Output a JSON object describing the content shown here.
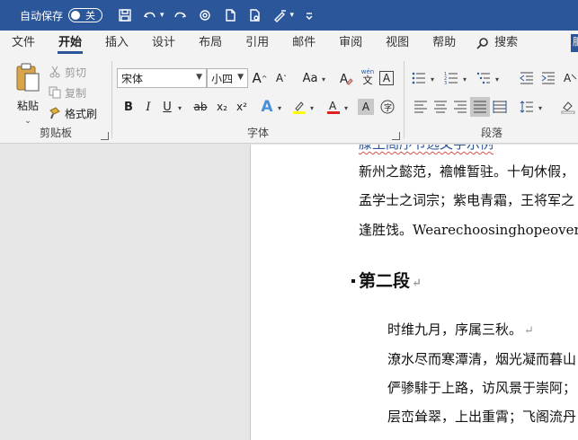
{
  "titlebar": {
    "autosave_label": "自动保存",
    "toggle_state": "关"
  },
  "tabs": {
    "items": [
      "文件",
      "开始",
      "插入",
      "设计",
      "布局",
      "引用",
      "邮件",
      "审阅",
      "视图",
      "帮助"
    ],
    "active": "开始",
    "search_label": "搜索",
    "overflow": "服"
  },
  "ribbon": {
    "clipboard": {
      "group_label": "剪贴板",
      "paste_label": "粘贴",
      "cut_label": "剪切",
      "copy_label": "复制",
      "format_painter_label": "格式刷"
    },
    "font": {
      "group_label": "字体",
      "font_name": "宋体",
      "font_size": "小四",
      "bold": "B",
      "italic": "I",
      "underline": "U",
      "strikethrough": "ab",
      "subscript": "x₂",
      "superscript": "x²",
      "text_effects": "A",
      "change_case": "Aa",
      "grow": "A",
      "shrink": "A",
      "phonetic_top": "wén",
      "phonetic_bottom": "文",
      "clear": "A"
    },
    "paragraph": {
      "group_label": "段落"
    }
  },
  "document": {
    "lines": [
      "新州之懿范，襜帷暂驻。十旬休假，",
      "孟学士之词宗；紫电青霜，王将军之",
      "逢胜饯。Wearechoosinghopeoverfear"
    ],
    "heading": "第二段",
    "para_lines": [
      "时维九月，序属三秋。",
      "潦水尽而寒潭清，烟光凝而暮山",
      "俨骖騑于上路，访风景于崇阿；",
      "层峦耸翠，上出重霄；飞阁流丹"
    ]
  }
}
